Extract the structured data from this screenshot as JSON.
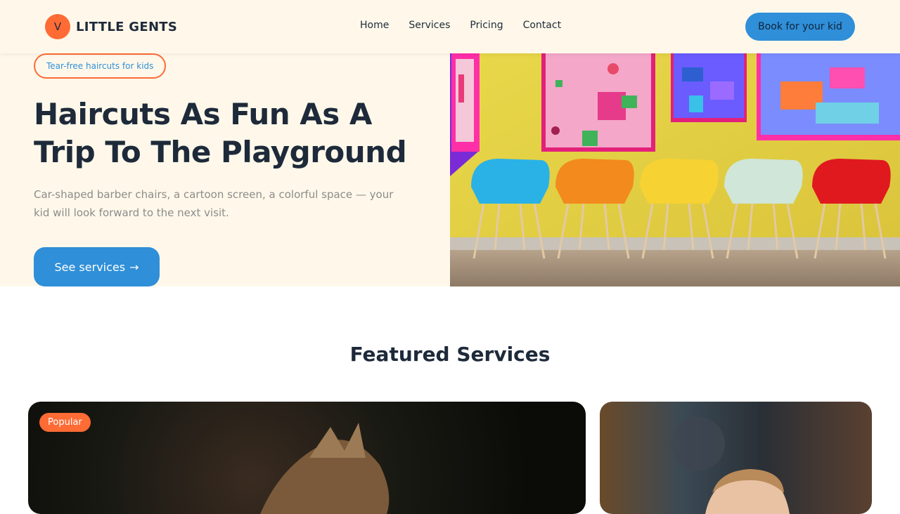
{
  "brand": {
    "logo_letter": "V",
    "name": "LITTLE GENTS"
  },
  "nav": {
    "items": [
      "Home",
      "Services",
      "Pricing",
      "Contact"
    ]
  },
  "header": {
    "book_label": "Book for your kid"
  },
  "hero": {
    "tag": "Tear-free haircuts for kids",
    "title": "Haircuts As Fun As A Trip To The Playground",
    "description": "Car-shaped barber chairs, a cartoon screen, a colorful space — your kid will look forward to the next visit.",
    "cta_label": "See services",
    "cta_arrow": "→"
  },
  "featured": {
    "title": "Featured Services",
    "cards": [
      {
        "badge": "Popular"
      },
      {
        "badge": ""
      }
    ]
  },
  "colors": {
    "accent": "#2f8fd8",
    "brand_orange": "#ff6b35",
    "cream": "#fff8ea",
    "ink": "#1e2a3a"
  }
}
